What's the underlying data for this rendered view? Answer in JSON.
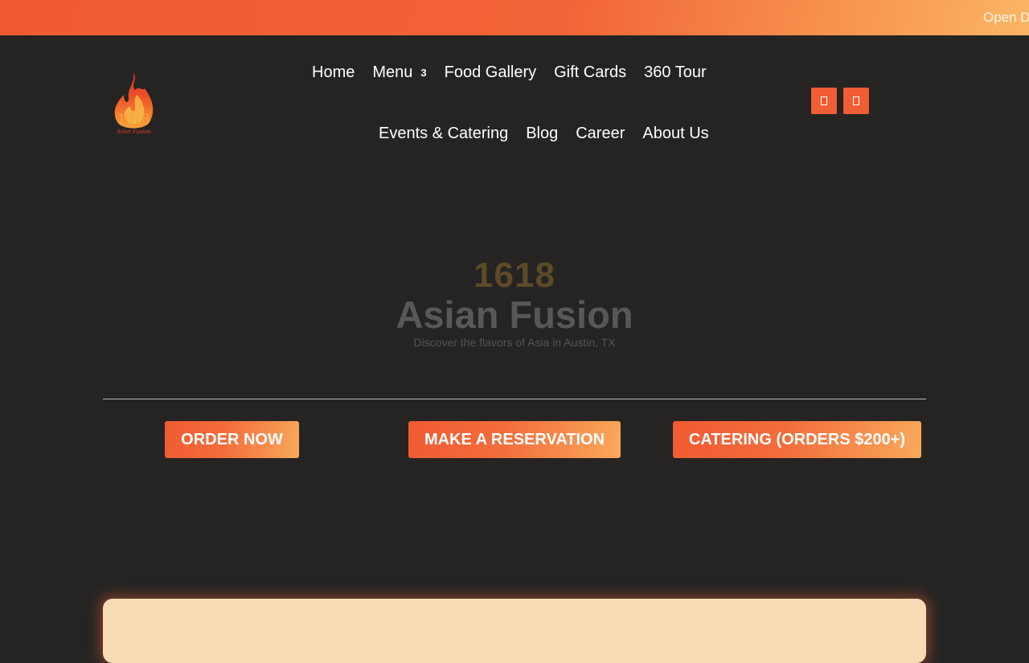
{
  "topbar": {
    "text": "Open D"
  },
  "logo": {
    "number": "1618",
    "tagline": "Asian Fusion"
  },
  "nav": {
    "row1": [
      {
        "label": "Home"
      },
      {
        "label": "Menu",
        "badge": "3"
      },
      {
        "label": "Food Gallery"
      },
      {
        "label": "Gift Cards"
      },
      {
        "label": "360 Tour"
      }
    ],
    "row2": [
      {
        "label": "Events & Catering"
      },
      {
        "label": "Blog"
      },
      {
        "label": "Career"
      },
      {
        "label": "About Us"
      }
    ]
  },
  "social": [
    {
      "icon": "facebook-icon"
    },
    {
      "icon": "instagram-icon"
    }
  ],
  "hero": {
    "number": "1618",
    "title": "Asian Fusion",
    "subtitle": "Discover the flavors of Asia in Austin, TX"
  },
  "cta": {
    "order": "ORDER NOW",
    "reservation": "MAKE A RESERVATION",
    "catering": "CATERING (ORDERS $200+)"
  },
  "colors": {
    "accent": "#f15d34",
    "accent_light": "#fbb565",
    "background": "#252423",
    "card": "#f7dbb4"
  }
}
